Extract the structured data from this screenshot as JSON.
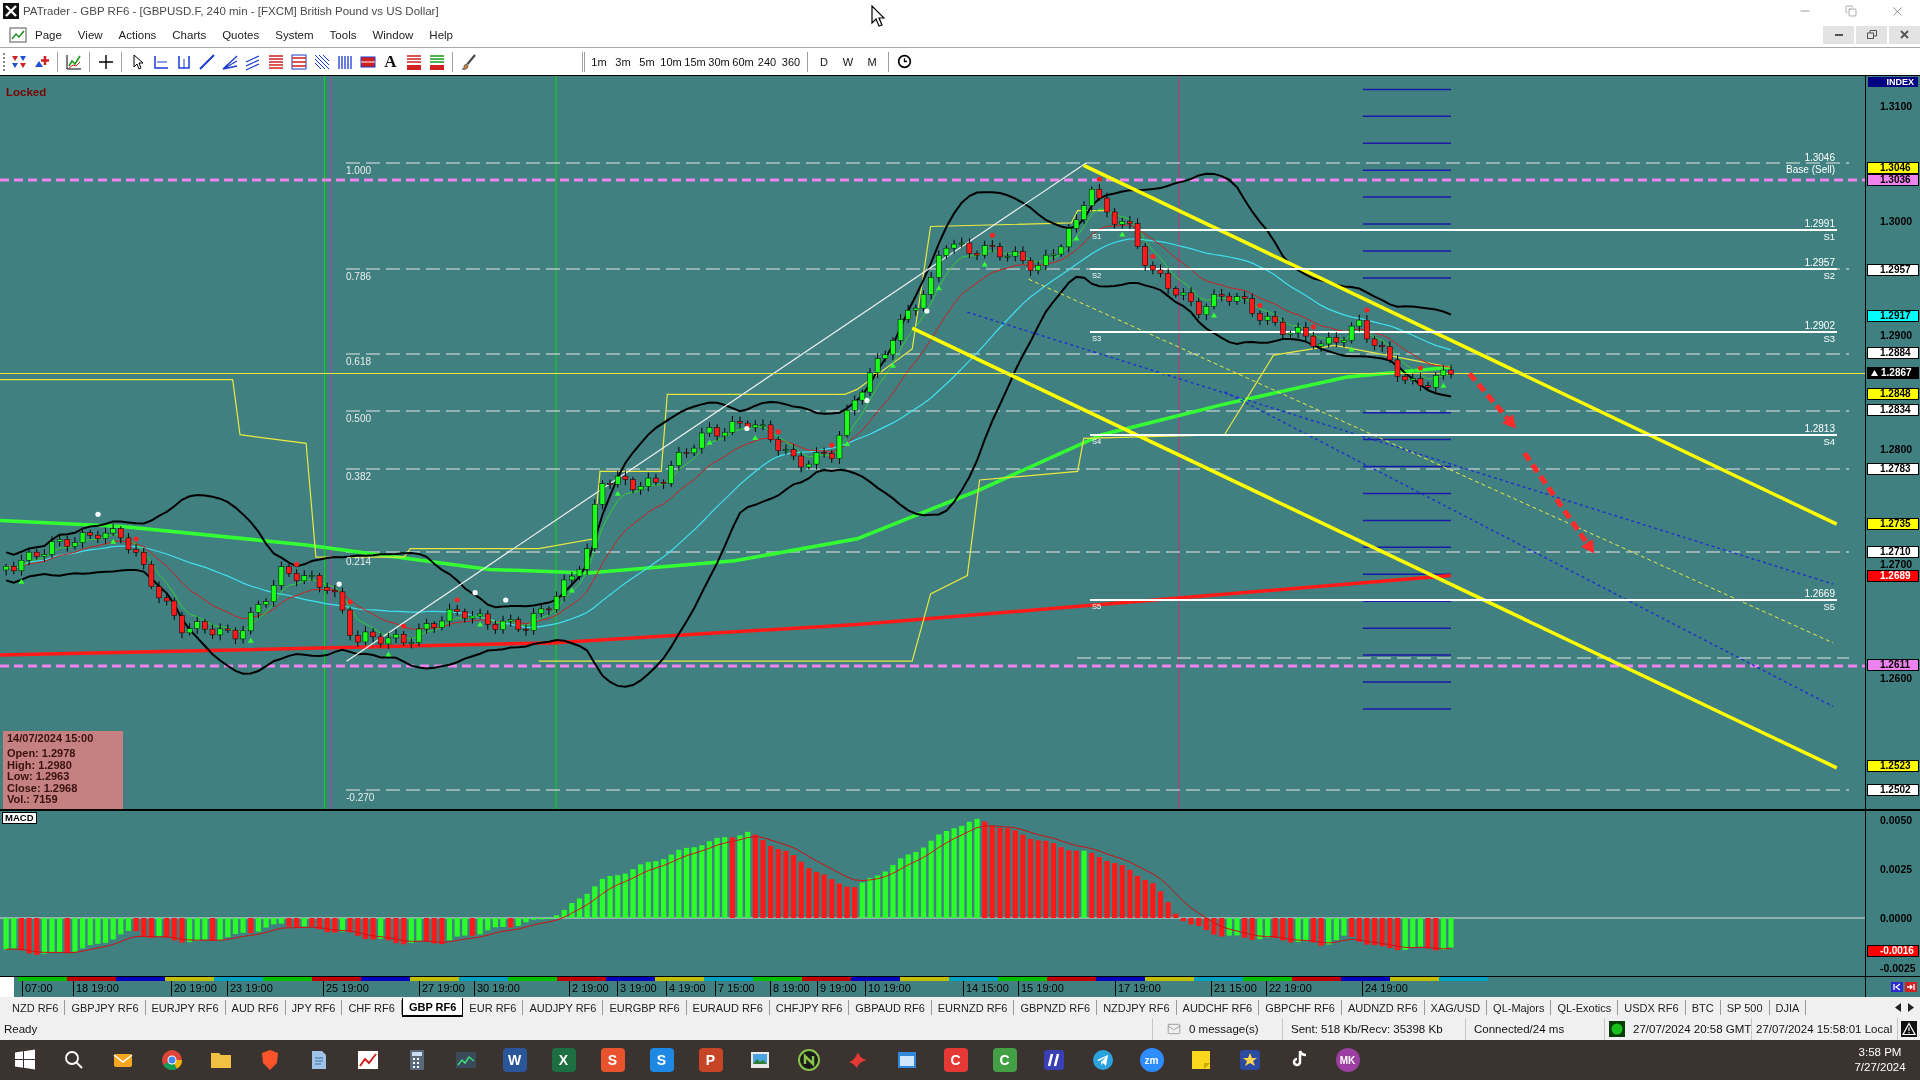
{
  "window": {
    "title": "PATrader - GBP RF6 - [GBPUSD.F, 240 min - [FXCM] British Pound vs US Dollar]"
  },
  "menu": [
    "Page",
    "View",
    "Actions",
    "Charts",
    "Quotes",
    "System",
    "Tools",
    "Window",
    "Help"
  ],
  "toolbar": {
    "text_tool": "A",
    "timeframes": [
      "1m",
      "3m",
      "5m",
      "10m",
      "15m",
      "30m",
      "60m",
      "240",
      "360"
    ],
    "periods": [
      "D",
      "W",
      "M"
    ]
  },
  "chart": {
    "lock_status": "Locked",
    "fibonacci_levels": [
      "1.000",
      "0.786",
      "0.618",
      "0.500",
      "0.382",
      "0.214",
      "-0.270"
    ],
    "base_level": {
      "price": "1.3046",
      "label": "Base (Sell)"
    },
    "support_levels": [
      {
        "start_label": "S1",
        "price": "1.2991",
        "label": "S1"
      },
      {
        "start_label": "S2",
        "price": "1.2957",
        "label": "S2"
      },
      {
        "start_label": "S3",
        "price": "1.2902",
        "label": "S3"
      },
      {
        "start_label": "S4",
        "price": "1.2813",
        "label": "S4"
      },
      {
        "start_label": "S5",
        "price": "1.2669",
        "label": "S5"
      }
    ],
    "info_box": {
      "date": "14/07/2024 15:00",
      "lines": [
        "Open: 1.2978",
        "High: 1.2980",
        "Low: 1.2963",
        "Close: 1.2968",
        "Vol.: 7159"
      ]
    },
    "price_axis": {
      "header": "INDEX",
      "ticks": [
        "1.3100",
        "1.3000",
        "1.2900",
        "1.2800",
        "1.2700",
        "1.2600"
      ],
      "tags": [
        {
          "text": "1.3046",
          "color": "#ffff00",
          "kind": "level"
        },
        {
          "text": "1.3036",
          "color": "#ee82ee",
          "kind": "level"
        },
        {
          "text": "1.2957",
          "color": "#ffffff",
          "kind": "level"
        },
        {
          "text": "1.2917",
          "color": "#00ffff",
          "kind": "level"
        },
        {
          "text": "1.2884",
          "color": "#ffffff",
          "kind": "level"
        },
        {
          "text": "1.2867",
          "color": "#000000",
          "kind": "current"
        },
        {
          "text": "1.2848",
          "color": "#ffff00",
          "kind": "level"
        },
        {
          "text": "1.2834",
          "color": "#ffffff",
          "kind": "level"
        },
        {
          "text": "1.2783",
          "color": "#ffffff",
          "kind": "level"
        },
        {
          "text": "1.2735",
          "color": "#ffff00",
          "kind": "level"
        },
        {
          "text": "1.2710",
          "color": "#ffffff",
          "kind": "level"
        },
        {
          "text": "1.2689",
          "color": "#ff0000",
          "kind": "level"
        },
        {
          "text": "1.2611",
          "color": "#ee82ee",
          "kind": "level"
        },
        {
          "text": "1.2523",
          "color": "#ffff00",
          "kind": "level"
        },
        {
          "text": "1.2502",
          "color": "#ffffff",
          "kind": "level"
        }
      ]
    }
  },
  "macd": {
    "title": "MACD",
    "axis": {
      "ticks": [
        "0.0050",
        "0.0025",
        "0.0000",
        "-0.0025"
      ],
      "tags": [
        {
          "text": "-0.0016",
          "color": "#ff0000"
        }
      ]
    }
  },
  "time_axis": {
    "labels": [
      "07:00",
      "18 19:00",
      "20 19:00",
      "23 19:00",
      "25 19:00",
      "27 19:00",
      "30 19:00",
      "2 19:00",
      "3 19:00",
      "4 19:00",
      "7 15:00",
      "8 19:00",
      "9 19:00",
      "10 19:00",
      "14 15:00",
      "15 19:00",
      "17 19:00",
      "21 15:00",
      "22 19:00",
      "24 19:00"
    ]
  },
  "tabs": [
    {
      "label": "NZD RF6",
      "selected": false
    },
    {
      "label": "GBPJPY RF6",
      "selected": false
    },
    {
      "label": "EURJPY RF6",
      "selected": false
    },
    {
      "label": "AUD RF6",
      "selected": false
    },
    {
      "label": "JPY RF6",
      "selected": false
    },
    {
      "label": "CHF RF6",
      "selected": false
    },
    {
      "label": "GBP RF6",
      "selected": true
    },
    {
      "label": "EUR RF6",
      "selected": false
    },
    {
      "label": "AUDJPY RF6",
      "selected": false
    },
    {
      "label": "EURGBP RF6",
      "selected": false
    },
    {
      "label": "EURAUD RF6",
      "selected": false
    },
    {
      "label": "CHFJPY RF6",
      "selected": false
    },
    {
      "label": "GBPAUD RF6",
      "selected": false
    },
    {
      "label": "EURNZD RF6",
      "selected": false
    },
    {
      "label": "GBPNZD RF6",
      "selected": false
    },
    {
      "label": "NZDJPY RF6",
      "selected": false
    },
    {
      "label": "AUDCHF RF6",
      "selected": false
    },
    {
      "label": "GBPCHF RF6",
      "selected": false
    },
    {
      "label": "AUDNZD RF6",
      "selected": false
    },
    {
      "label": "XAG/USD",
      "selected": false
    },
    {
      "label": "QL-Majors",
      "selected": false
    },
    {
      "label": "QL-Exotics",
      "selected": false
    },
    {
      "label": "USDX RF6",
      "selected": false
    },
    {
      "label": "BTC",
      "selected": false
    },
    {
      "label": "SP 500",
      "selected": false
    },
    {
      "label": "DJIA",
      "selected": false
    }
  ],
  "status_bar": {
    "state": "Ready",
    "messages": "0 message(s)",
    "traffic": "Sent: 518 Kb/Recv: 35398 Kb",
    "connection": "Connected/24 ms",
    "gmt_time": "27/07/2024 20:58 GMT",
    "local_time": "27/07/2024 15:58:01 Local"
  },
  "taskbar": {
    "tiles": [
      {
        "label": "W",
        "color": "#2b579a",
        "kind": "square"
      },
      {
        "label": "X",
        "color": "#1d6f42",
        "kind": "square"
      },
      {
        "label": "S",
        "color": "#e8522d",
        "kind": "square"
      },
      {
        "label": "S",
        "color": "#1e88e5",
        "kind": "square"
      },
      {
        "label": "P",
        "color": "#c84426",
        "kind": "square"
      },
      {
        "label": "C",
        "color": "#e53935",
        "kind": "square"
      },
      {
        "label": "C",
        "color": "#43a047",
        "kind": "square"
      },
      {
        "label": "zm",
        "color": "#2d8cff",
        "kind": "round"
      }
    ],
    "avatar": {
      "initials": "MK",
      "color": "#9c3fa0"
    },
    "time": "3:58 PM",
    "date": "7/27/2024"
  }
}
